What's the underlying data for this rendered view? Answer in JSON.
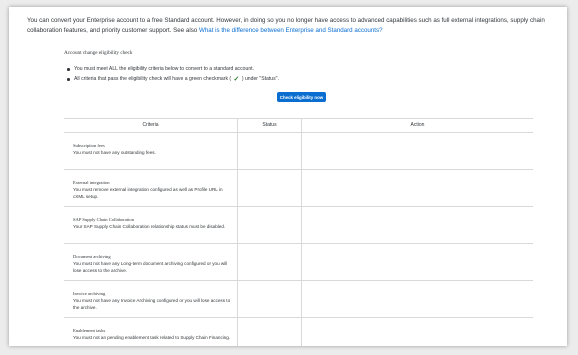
{
  "intro": {
    "text": "You can convert your Enterprise account to a free Standard account. However, in doing so you no longer have access to advanced capabilities such as full external integrations, supply chain collaboration features, and priority customer support. See also",
    "link": "What is the difference between Enterprise and Standard accounts?"
  },
  "check": {
    "title": "Account change eligibility check",
    "bullet1": "You must meet ALL the eligibility criteria below to convert to a standard account.",
    "bullet2_before": "All criteria that pass the eligibility check will have a green checkmark (",
    "bullet2_after": ") under \"Status\".",
    "button_label": "Check eligibility now"
  },
  "table": {
    "headers": {
      "criteria": "Criteria",
      "status": "Status",
      "action": "Action"
    },
    "rows": [
      {
        "title": "Subscription fees",
        "desc": "You must not have any outstanding fees."
      },
      {
        "title": "External integration",
        "desc": "You must remove external integration configured as well as Profile URL in cXML setup."
      },
      {
        "title": "SAP Supply Chain Collaboration",
        "desc": "Your SAP Supply Chain Collaboration relationship status must be disabled."
      },
      {
        "title": "Document archiving",
        "desc": "You must not have any Long-term document archiving configured or you will lose access to the archive."
      },
      {
        "title": "Invoice archiving",
        "desc": "You must not have any Invoice Archiving configured or you will lose access to the archive."
      },
      {
        "title": "Enablement tasks",
        "desc": "You must not an pending enablement task related to Supply Chain Financing."
      }
    ]
  },
  "colors": {
    "accent": "#0a6ed1",
    "check_green": "#2b7d2b",
    "text": "#32363a",
    "border": "#d9d9d9"
  },
  "icons": {
    "status_check": "green-checkmark-icon"
  }
}
